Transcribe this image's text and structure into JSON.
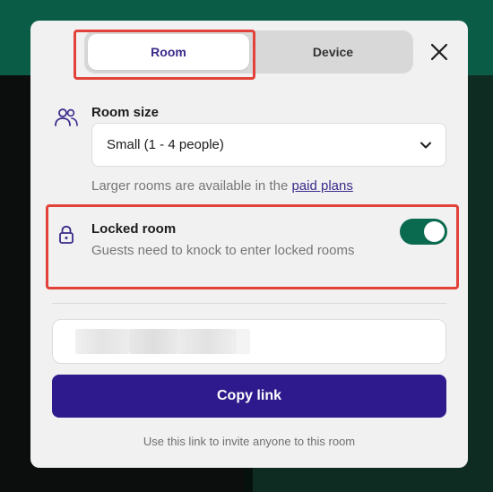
{
  "tabs": [
    {
      "label": "Room",
      "selected": true
    },
    {
      "label": "Device",
      "selected": false
    }
  ],
  "room_size": {
    "label": "Room size",
    "selected_value": "Small (1 - 4 people)",
    "hint_text": "Larger rooms are available in the ",
    "hint_link": "paid plans"
  },
  "locked_room": {
    "title": "Locked room",
    "description": "Guests need to knock to enter locked rooms",
    "enabled": true
  },
  "copy_button": {
    "label": "Copy link"
  },
  "invite_hint": "Use this link to invite anyone to this room",
  "colors": {
    "accent": "#2e1a8c",
    "toggle_on": "#0a6a4f",
    "highlight": "#e2423a"
  },
  "icons": [
    "close-icon",
    "people-icon",
    "chevron-down-icon",
    "lock-icon"
  ]
}
